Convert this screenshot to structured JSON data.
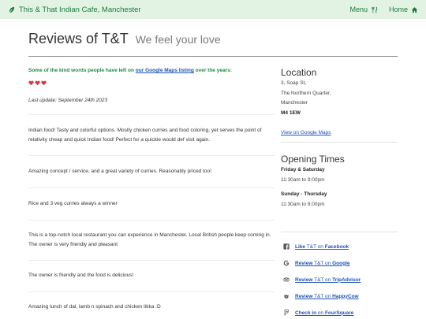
{
  "nav": {
    "brand": "This & That Indian Cafe, Manchester",
    "menu_label": "Menu",
    "home_label": "Home"
  },
  "page": {
    "title": "Reviews of T&T",
    "subtitle": "We feel your love"
  },
  "intro": {
    "before": "Some of the kind words people have left on ",
    "link": "our Google Maps listing",
    "after": " over the years:"
  },
  "last_update": "Last update: September 24th 2023",
  "reviews": [
    "Indian food! Tasty and colorful options. Mostly chicken curries and food coloring, yet serves the point of relativity cheap and quick Indian food! Perfect for a quickie would def visit again.",
    "Amazing concept / service, and a great variety of curries. Reasonably priced too!",
    "Rice and 3 veg curries always a winner",
    "This is a top-notch local restaurant you can experience in Manchester. Local British people keep coming in. The owner is very friendly and pleasant",
    "The owner is friendly and the food is delicious!",
    "Amazing lunch of dal, lamb n spinach and chicken tikka :D"
  ],
  "location": {
    "heading": "Location",
    "line1": "3, Soap St,",
    "line2": "The Northern Quarter,",
    "line3": "Manchester",
    "postcode": "M4 1EW",
    "map_link": "View on Google Maps"
  },
  "opening": {
    "heading": "Opening Times",
    "days1": "Friday & Saturday",
    "hours1": "11:30am to 9:00pm",
    "days2": "Sunday - Thursday",
    "hours2": "11:30am to 8:00pm"
  },
  "social": [
    {
      "verb": "Like",
      "mid": " T&T on ",
      "site": "Facebook",
      "icon": "facebook-icon"
    },
    {
      "verb": "Review",
      "mid": " T&T on ",
      "site": "Google",
      "icon": "google-icon"
    },
    {
      "verb": "Review",
      "mid": " T&T on ",
      "site": "TripAdvisor",
      "icon": "tripadvisor-icon"
    },
    {
      "verb": "Review",
      "mid": " T&T on ",
      "site": "HappyCow",
      "icon": "happycow-icon"
    },
    {
      "verb": "Check in",
      "mid": " on ",
      "site": "FourSquare",
      "icon": "foursquare-icon"
    }
  ],
  "colors": {
    "navbar_bg": "#e2f3e4",
    "brand_green": "#1a7a3c",
    "link_blue": "#1d52b8",
    "heart_red": "#d9363e"
  }
}
